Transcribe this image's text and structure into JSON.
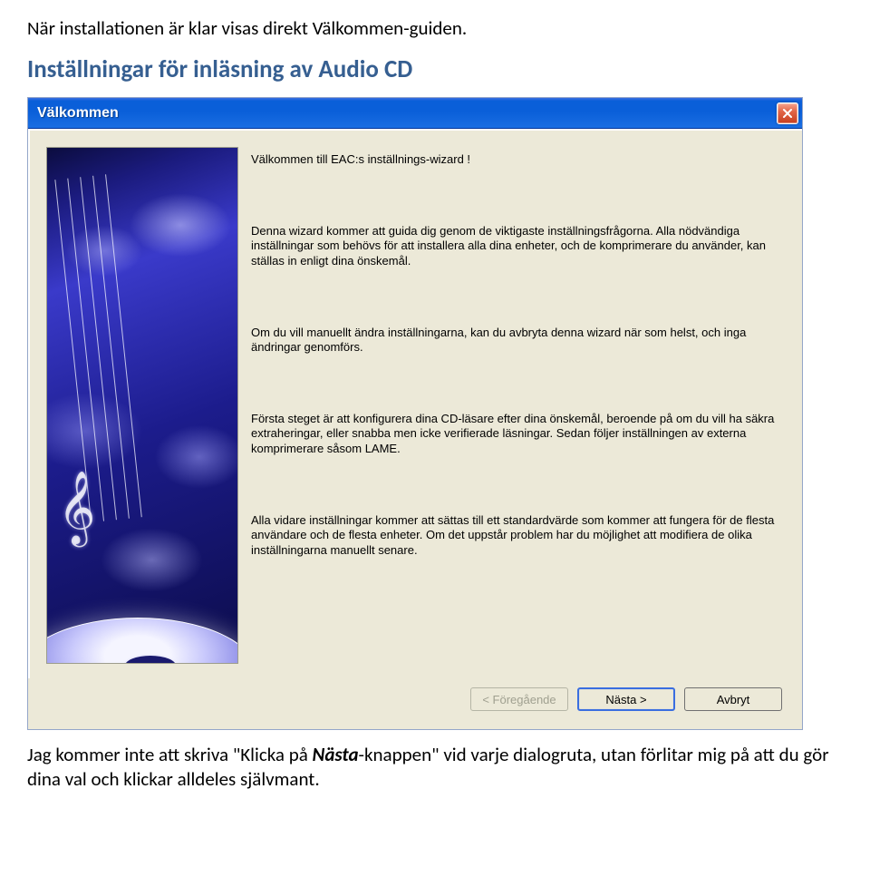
{
  "doc": {
    "line1": "När installationen är klar visas direkt Välkommen-guiden.",
    "heading": "Inställningar för inläsning av Audio CD",
    "line2_pre": "Jag kommer inte att skriva \"Klicka på ",
    "line2_em": "Nästa",
    "line2_post": "-knappen\" vid varje dialogruta, utan förlitar mig på att du gör dina val och klickar alldeles självmant."
  },
  "dialog": {
    "title": "Välkommen",
    "p1": "Välkommen till EAC:s inställnings-wizard !",
    "p2": "Denna wizard kommer att guida dig genom de viktigaste inställningsfrågorna. Alla nödvändiga inställningar som behövs för att installera alla dina enheter, och de komprimerare du använder, kan ställas in enligt dina önskemål.",
    "p3": "Om du vill manuellt ändra inställningarna, kan du avbryta denna wizard när som helst, och inga ändringar genomförs.",
    "p4": "Första steget är att konfigurera dina CD-läsare efter dina önskemål, beroende på om du vill ha säkra extraheringar, eller snabba men icke verifierade läsningar. Sedan följer inställningen av externa komprimerare såsom LAME.",
    "p5": "Alla vidare inställningar kommer att sättas till ett standardvärde som kommer att fungera för de flesta användare och de flesta enheter. Om det uppstår problem har du möjlighet att modifiera de olika inställningarna manuellt senare.",
    "buttons": {
      "back": "< Föregående",
      "next": "Nästa >",
      "cancel": "Avbryt"
    }
  }
}
